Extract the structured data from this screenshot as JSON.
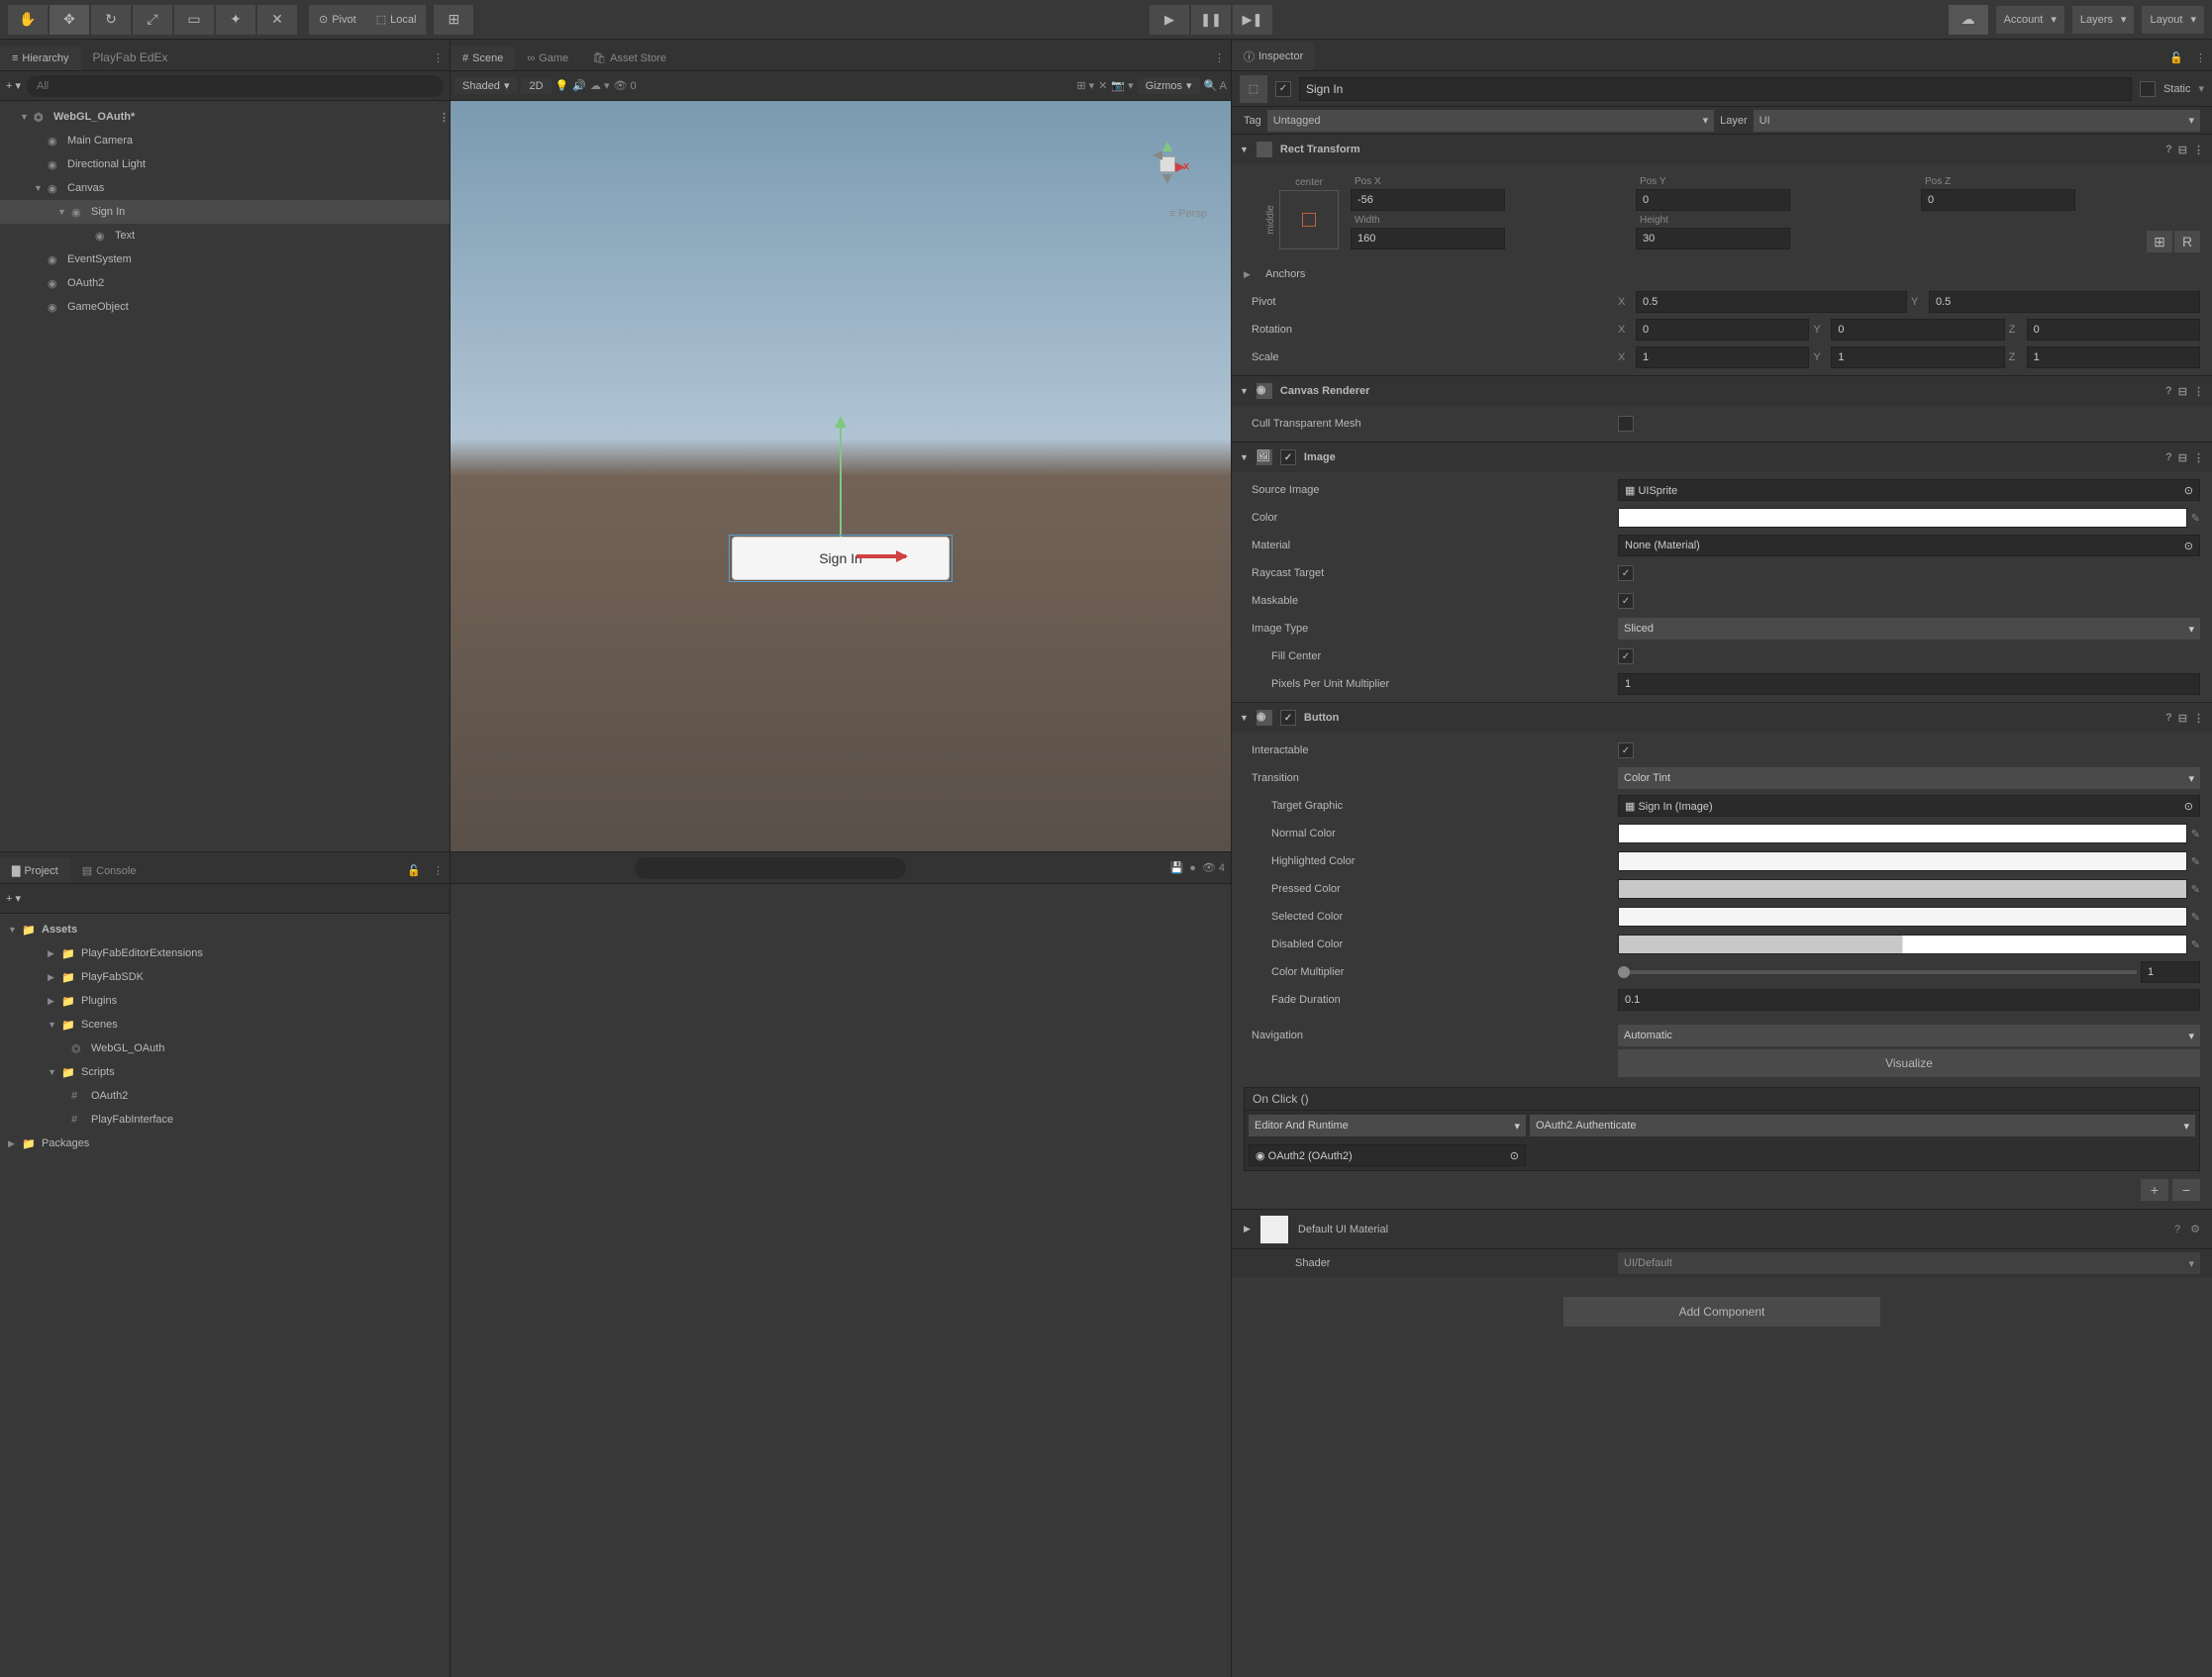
{
  "top": {
    "pivot": "Pivot",
    "local": "Local",
    "account": "Account",
    "layers": "Layers",
    "layout": "Layout"
  },
  "hierarchy": {
    "tab1": "Hierarchy",
    "tab2": "PlayFab EdEx",
    "search_ph": "All",
    "scene": "WebGL_OAuth*",
    "items": {
      "main_camera": "Main Camera",
      "directional_light": "Directional Light",
      "canvas": "Canvas",
      "sign_in": "Sign In",
      "text": "Text",
      "event_system": "EventSystem",
      "oauth2": "OAuth2",
      "game_object": "GameObject"
    }
  },
  "scene": {
    "tab_scene": "Scene",
    "tab_game": "Game",
    "tab_asset": "Asset Store",
    "shaded": "Shaded",
    "two_d": "2D",
    "gizmos": "Gizmos",
    "persp": "Persp",
    "x_label": "x",
    "button_label": "Sign In"
  },
  "project": {
    "tab_project": "Project",
    "tab_console": "Console",
    "hidden_count": "4",
    "assets": "Assets",
    "items": {
      "pf_ext": "PlayFabEditorExtensions",
      "pf_sdk": "PlayFabSDK",
      "plugins": "Plugins",
      "scenes": "Scenes",
      "webgl_oauth": "WebGL_OAuth",
      "scripts": "Scripts",
      "oauth2": "OAuth2",
      "pf_interface": "PlayFabInterface"
    },
    "packages": "Packages"
  },
  "inspector": {
    "tab": "Inspector",
    "name": "Sign In",
    "static": "Static",
    "tag_label": "Tag",
    "tag_value": "Untagged",
    "layer_label": "Layer",
    "layer_value": "UI",
    "rect": {
      "title": "Rect Transform",
      "anchor_h": "center",
      "anchor_v": "middle",
      "posx_label": "Pos X",
      "posx": "-56",
      "posy_label": "Pos Y",
      "posy": "0",
      "posz_label": "Pos Z",
      "posz": "0",
      "width_label": "Width",
      "width": "160",
      "height_label": "Height",
      "height": "30",
      "anchors": "Anchors",
      "pivot": "Pivot",
      "pivot_x": "0.5",
      "pivot_y": "0.5",
      "rotation": "Rotation",
      "rot_x": "0",
      "rot_y": "0",
      "rot_z": "0",
      "scale": "Scale",
      "scale_x": "1",
      "scale_y": "1",
      "scale_z": "1",
      "r_btn": "R"
    },
    "canvas_renderer": {
      "title": "Canvas Renderer",
      "cull": "Cull Transparent Mesh"
    },
    "image": {
      "title": "Image",
      "source": "Source Image",
      "source_val": "UISprite",
      "color": "Color",
      "material": "Material",
      "material_val": "None (Material)",
      "raycast": "Raycast Target",
      "maskable": "Maskable",
      "image_type": "Image Type",
      "image_type_val": "Sliced",
      "fill_center": "Fill Center",
      "ppu": "Pixels Per Unit Multiplier",
      "ppu_val": "1"
    },
    "button": {
      "title": "Button",
      "interactable": "Interactable",
      "transition": "Transition",
      "transition_val": "Color Tint",
      "target_graphic": "Target Graphic",
      "target_graphic_val": "Sign In (Image)",
      "normal": "Normal Color",
      "highlighted": "Highlighted Color",
      "pressed": "Pressed Color",
      "selected": "Selected Color",
      "disabled": "Disabled Color",
      "color_mult": "Color Multiplier",
      "color_mult_val": "1",
      "fade": "Fade Duration",
      "fade_val": "0.1",
      "navigation": "Navigation",
      "navigation_val": "Automatic",
      "visualize": "Visualize",
      "onclick": "On Click ()",
      "runtime": "Editor And Runtime",
      "method": "OAuth2.Authenticate",
      "target_obj": "OAuth2 (OAuth2)"
    },
    "material": {
      "title": "Default UI Material",
      "shader_label": "Shader",
      "shader_val": "UI/Default"
    },
    "add_component": "Add Component"
  },
  "colors": {
    "normal": "#ffffff",
    "highlighted": "#f5f5f5",
    "pressed": "#c8c8c8",
    "selected": "#f5f5f5",
    "disabled_base": "#c8c8c8"
  }
}
